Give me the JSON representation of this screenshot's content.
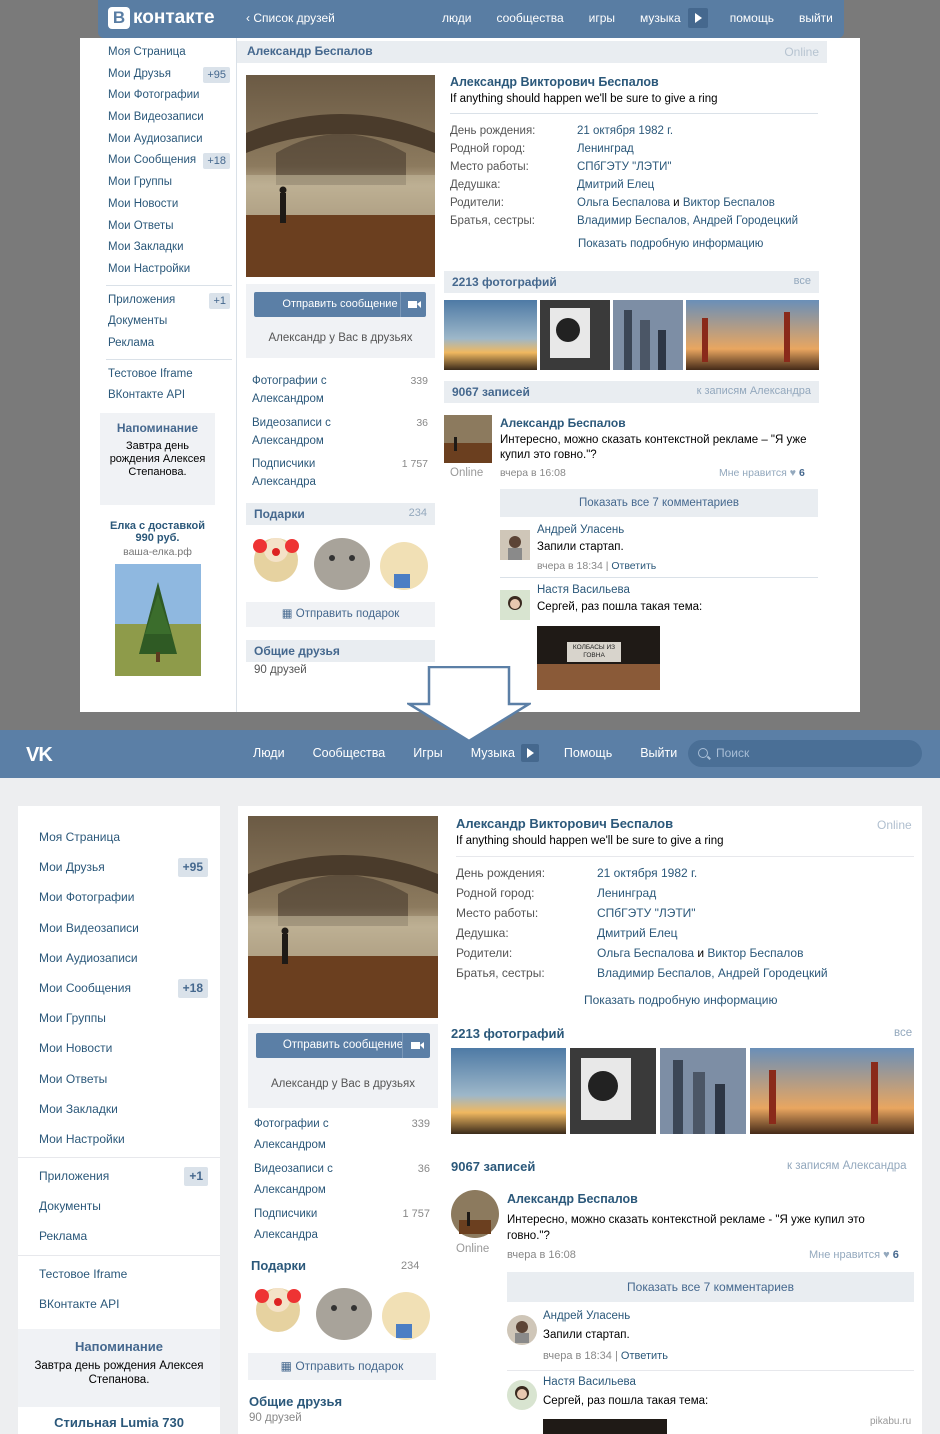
{
  "old": {
    "logo": "контакте",
    "logo_letter": "В",
    "back_link": "Список друзей",
    "nav": [
      "люди",
      "сообщества",
      "игры",
      "музыка",
      "помощь",
      "выйти"
    ],
    "menu": [
      {
        "label": "Моя Страница"
      },
      {
        "label": "Мои Друзья",
        "badge": "+95"
      },
      {
        "label": "Мои Фотографии"
      },
      {
        "label": "Мои Видеозаписи"
      },
      {
        "label": "Мои Аудиозаписи"
      },
      {
        "label": "Мои Сообщения",
        "badge": "+18"
      },
      {
        "label": "Мои Группы"
      },
      {
        "label": "Мои Новости"
      },
      {
        "label": "Мои Ответы"
      },
      {
        "label": "Мои Закладки"
      },
      {
        "label": "Мои Настройки"
      }
    ],
    "menu2": [
      {
        "label": "Приложения",
        "badge": "+1"
      },
      {
        "label": "Документы"
      },
      {
        "label": "Реклама"
      }
    ],
    "menu3": [
      {
        "label": "Тестовое Iframe"
      },
      {
        "label": "ВКонтакте API"
      }
    ],
    "reminder_title": "Напоминание",
    "reminder_text": "Завтра день рождения Алексея Степанова.",
    "ad_title": "Елка с доставкой 990 руб.",
    "ad_domain": "ваша-елка.рф",
    "profile_header": "Александр Беспалов",
    "online": "Online",
    "send_message": "Отправить сообщение",
    "in_friends": "Александр у Вас в друзьях",
    "stats": [
      {
        "label": "Фотографии с Александром",
        "count": "339"
      },
      {
        "label": "Видеозаписи с Александром",
        "count": "36"
      },
      {
        "label": "Подписчики Александра",
        "count": "1 757"
      }
    ],
    "gifts_title": "Подарки",
    "gifts_count": "234",
    "send_gift": "Отправить подарок",
    "common_friends_title": "Общие друзья",
    "common_friends_count": "90 друзей",
    "full_name": "Александр Викторович Беспалов",
    "status": "If anything should happen we'll be sure to give a ring",
    "info": [
      {
        "k": "День рождения:",
        "v": "21 октября 1982 г."
      },
      {
        "k": "Родной город:",
        "v": "Ленинград"
      },
      {
        "k": "Место работы:",
        "v": "СПбГЭТУ \"ЛЭТИ\""
      },
      {
        "k": "Дедушка:",
        "v": "Дмитрий Елец"
      },
      {
        "k": "Родители:",
        "v1": "Ольга Беспалова",
        "and": " и ",
        "v2": "Виктор Беспалов"
      },
      {
        "k": "Братья, сестры:",
        "v": "Владимир Беспалов, Андрей Городецкий"
      }
    ],
    "more_info": "Показать подробную информацию",
    "photos_title": "2213 фотографий",
    "photos_all": "все",
    "wall_title": "9067 записей",
    "wall_link": "к записям Александра",
    "post": {
      "author": "Александр Беспалов",
      "text": "Интересно, можно сказать контекстной рекламе – \"Я уже купил это говно.\"?",
      "time": "вчера в 16:08",
      "like_label": "Мне нравится",
      "likes": "6",
      "online": "Online"
    },
    "show_comments": "Показать все 7 комментариев",
    "comments": [
      {
        "name": "Андрей Уласень",
        "text": "Запили стартап.",
        "time": "вчера в 18:34",
        "reply": "Ответить"
      },
      {
        "name": "Настя Васильева",
        "text": "Сергей, раз пошла такая тема:"
      }
    ],
    "attached_sign": "КОЛБАСЫ ИЗ ГОВНА"
  },
  "new": {
    "logo": "VK",
    "nav": [
      "Люди",
      "Сообщества",
      "Игры",
      "Музыка",
      "Помощь",
      "Выйти"
    ],
    "search_placeholder": "Поиск",
    "menu": [
      {
        "label": "Моя Страница"
      },
      {
        "label": "Мои Друзья",
        "badge": "+95"
      },
      {
        "label": "Мои Фотографии"
      },
      {
        "label": "Мои Видеозаписи"
      },
      {
        "label": "Мои Аудиозаписи"
      },
      {
        "label": "Мои Сообщения",
        "badge": "+18"
      },
      {
        "label": "Мои Группы"
      },
      {
        "label": "Мои Новости"
      },
      {
        "label": "Мои Ответы"
      },
      {
        "label": "Мои Закладки"
      },
      {
        "label": "Мои Настройки"
      }
    ],
    "menu2": [
      {
        "label": "Приложения",
        "badge": "+1"
      },
      {
        "label": "Документы"
      },
      {
        "label": "Реклама"
      }
    ],
    "menu3": [
      {
        "label": "Тестовое Iframe"
      },
      {
        "label": "ВКонтакте API"
      }
    ],
    "reminder_title": "Напоминание",
    "reminder_text": "Завтра день рождения Алексея Степанова.",
    "ad_title": "Стильная Lumia 730",
    "online": "Online",
    "send_message": "Отправить сообщение",
    "in_friends": "Александр у Вас в друзьях",
    "stats": [
      {
        "label": "Фотографии с Александром",
        "count": "339"
      },
      {
        "label": "Видеозаписи с Александром",
        "count": "36"
      },
      {
        "label": "Подписчики Александра",
        "count": "1 757"
      }
    ],
    "gifts_title": "Подарки",
    "gifts_count": "234",
    "send_gift": "Отправить подарок",
    "common_friends_title": "Общие друзья",
    "common_friends_count": "90 друзей",
    "full_name": "Александр Викторович Беспалов",
    "status": "If anything should happen we'll be sure to give a ring",
    "info": [
      {
        "k": "День рождения:",
        "v": "21 октября 1982 г."
      },
      {
        "k": "Родной город:",
        "v": "Ленинград"
      },
      {
        "k": "Место работы:",
        "v": "СПбГЭТУ \"ЛЭТИ\""
      },
      {
        "k": "Дедушка:",
        "v": "Дмитрий Елец"
      },
      {
        "k": "Родители:",
        "v1": "Ольга Беспалова",
        "and": " и ",
        "v2": "Виктор Беспалов"
      },
      {
        "k": "Братья, сестры:",
        "v": "Владимир Беспалов, Андрей Городецкий"
      }
    ],
    "more_info": "Показать подробную информацию",
    "photos_title": "2213 фотографий",
    "photos_all": "все",
    "wall_title": "9067 записей",
    "wall_link": "к записям Александра",
    "post": {
      "author": "Александр Беспалов",
      "text": "Интересно, можно сказать контекстной рекламе - \"Я уже купил это говно.\"?",
      "time": "вчера в 16:08",
      "like_label": "Мне нравится",
      "likes": "6",
      "online": "Online"
    },
    "show_comments": "Показать все 7 комментариев",
    "comments": [
      {
        "name": "Андрей Уласень",
        "text": "Запили стартап.",
        "time": "вчера в 18:34",
        "reply": "Ответить"
      },
      {
        "name": "Настя Васильева",
        "text": "Сергей, раз пошла такая тема:"
      }
    ]
  },
  "watermark": "pikabu.ru",
  "colors": {
    "header": "#597da3",
    "link": "#2b587a",
    "accent": "#45688e",
    "badge_bg": "#dae2ea",
    "panel": "#f0f2f5"
  }
}
